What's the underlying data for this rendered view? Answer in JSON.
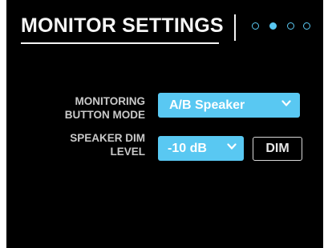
{
  "header": {
    "title": "MONITOR SETTINGS",
    "pagination": {
      "total": 4,
      "active_index": 1
    }
  },
  "settings": {
    "monitoring_button_mode": {
      "label_line1": "MONITORING",
      "label_line2": "BUTTON MODE",
      "value": "A/B Speaker"
    },
    "speaker_dim_level": {
      "label_line1": "SPEAKER DIM",
      "label_line2": "LEVEL",
      "value": "-10 dB"
    },
    "dim_button": {
      "label": "DIM"
    }
  },
  "colors": {
    "background": "#000000",
    "accent": "#59c8f2",
    "text": "#f5f5f5",
    "label_text": "#c9c9c9"
  },
  "icons": {
    "select_caret": "chevron-down-icon",
    "page_indicator": "page-dot-icon"
  }
}
